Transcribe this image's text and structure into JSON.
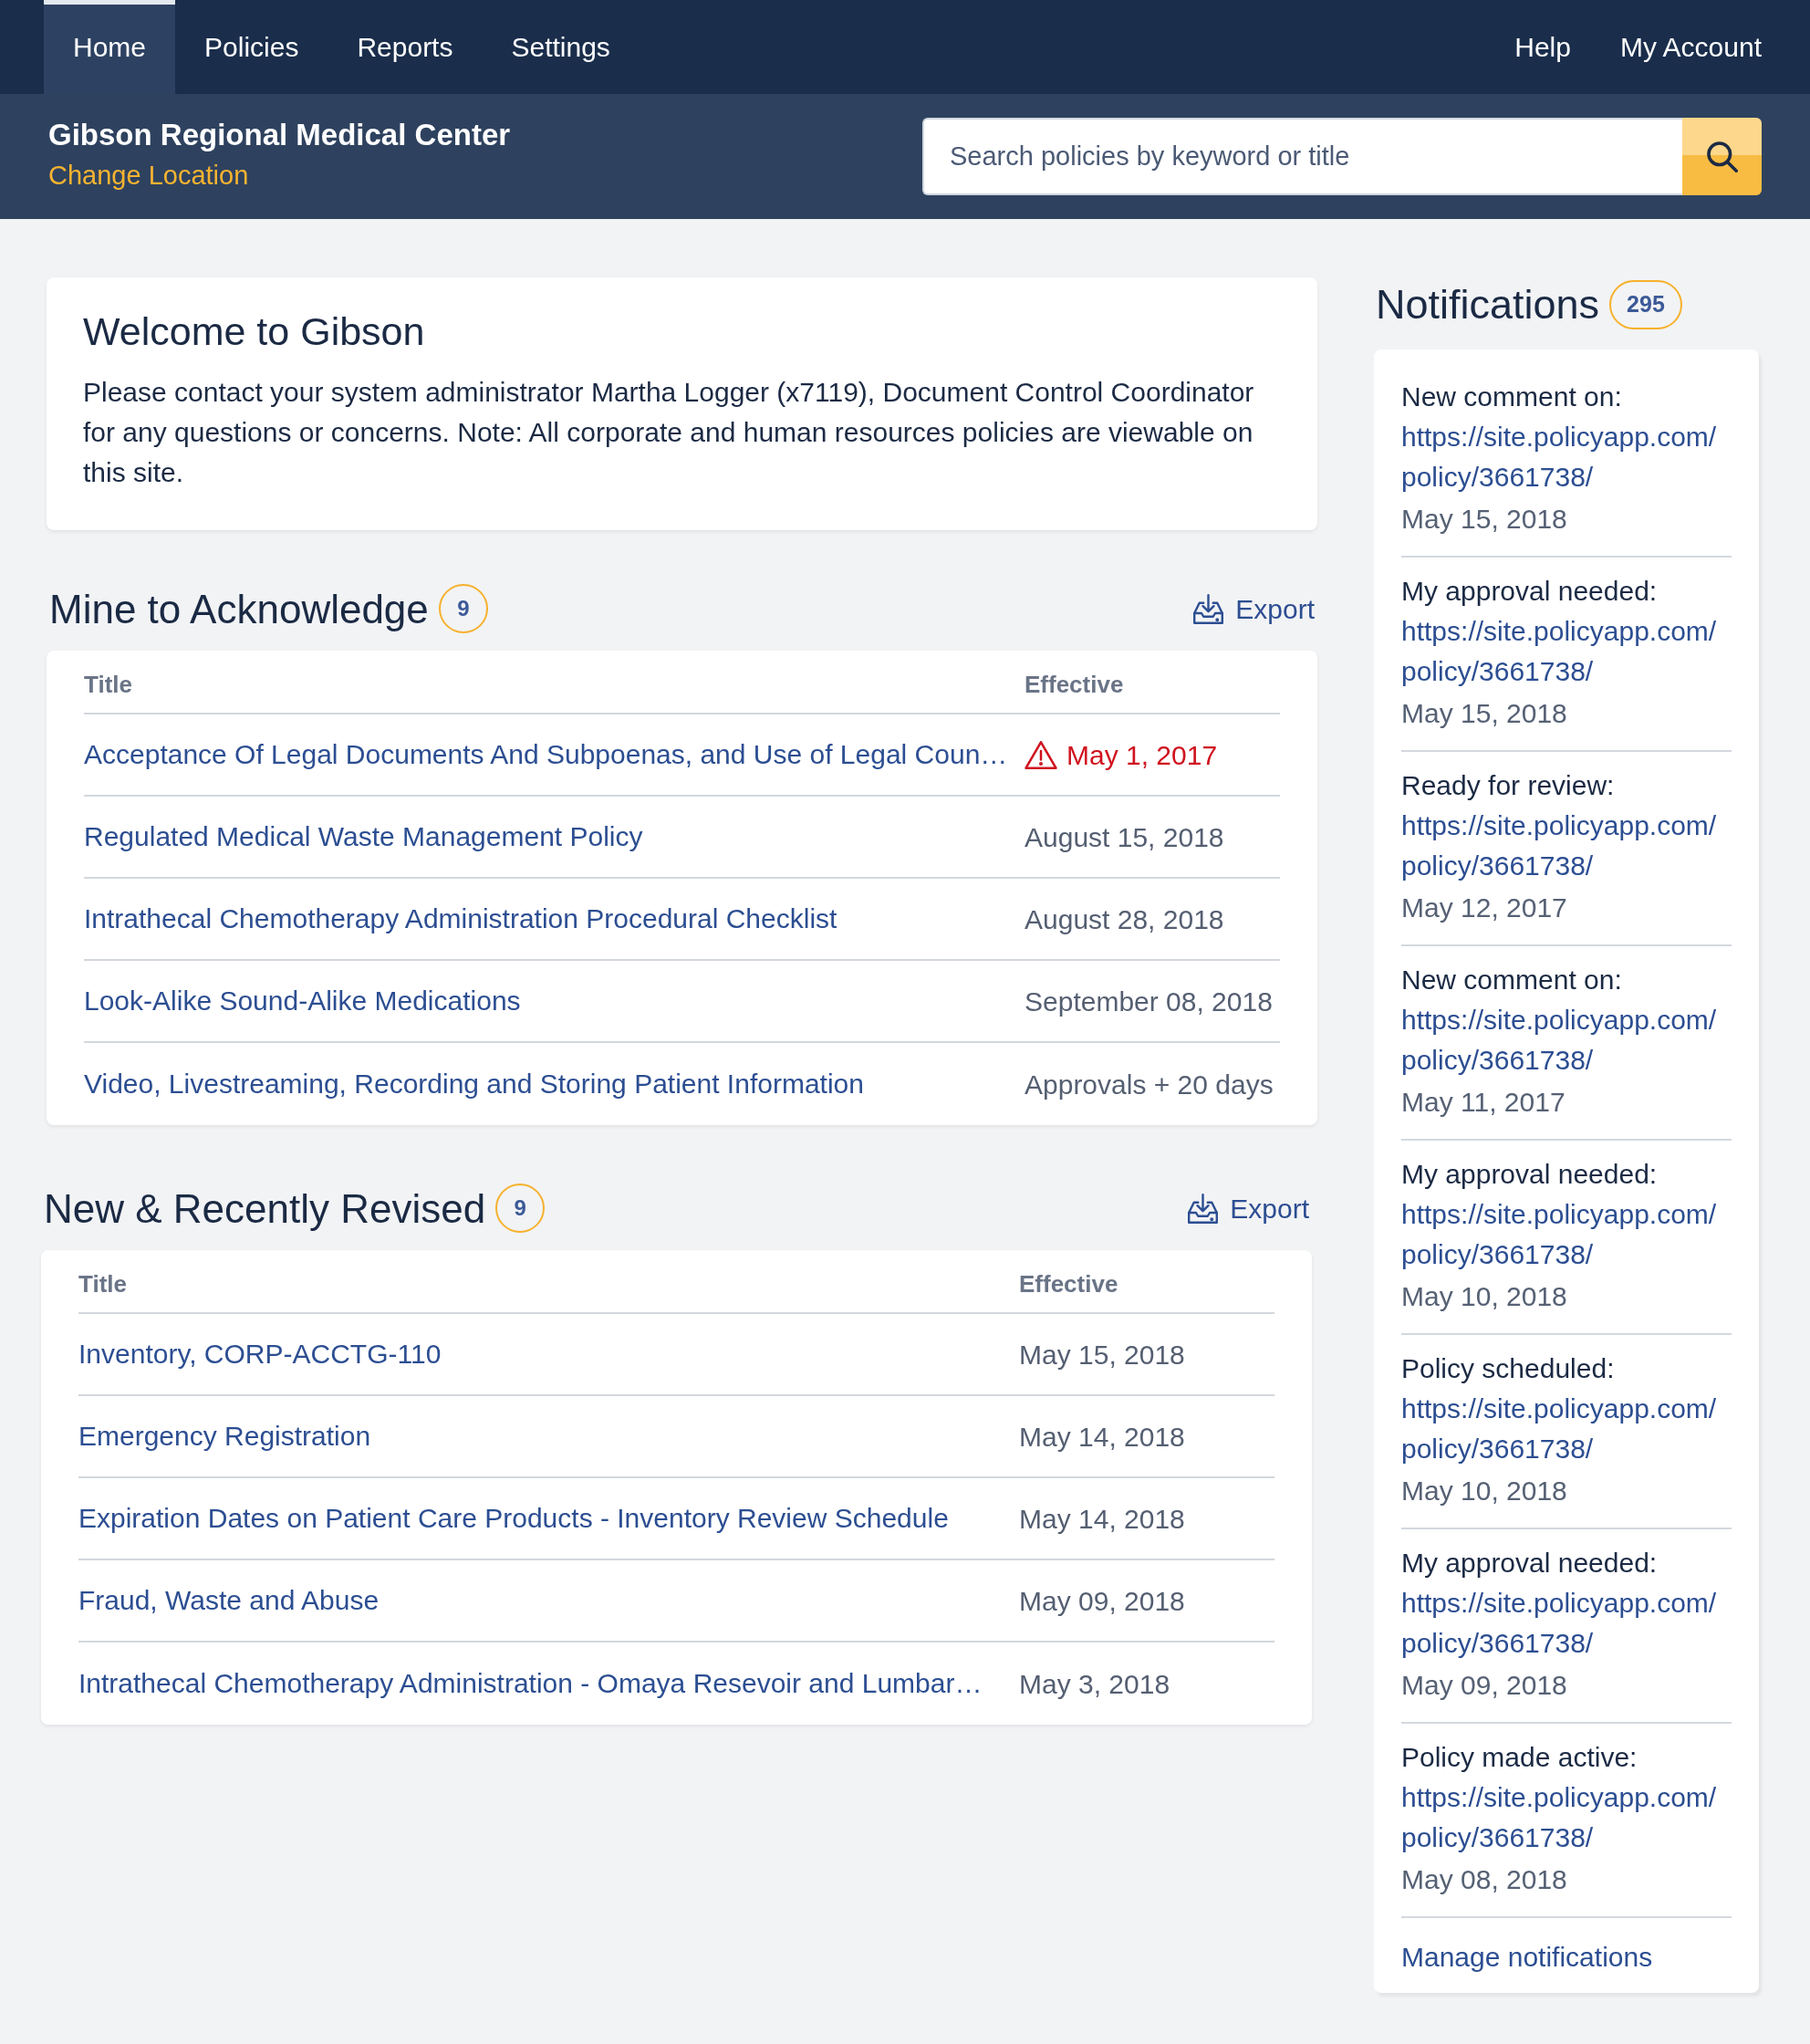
{
  "nav": {
    "tabs": [
      {
        "label": "Home",
        "selected": true
      },
      {
        "label": "Policies",
        "selected": false
      },
      {
        "label": "Reports",
        "selected": false
      },
      {
        "label": "Settings",
        "selected": false
      }
    ],
    "links": [
      "Help",
      "My Account"
    ]
  },
  "location": {
    "name": "Gibson Regional Medical Center",
    "change_link": "Change Location"
  },
  "search": {
    "placeholder": "Search policies by keyword or title"
  },
  "welcome": {
    "title": "Welcome to Gibson",
    "text": "Please contact your system administrator Martha Logger (x7119), Document Control Coordinator for any questions or concerns. Note: All corporate and human resources policies are viewable on this site."
  },
  "sections": [
    {
      "title": "Mine to Acknowledge",
      "count": "9",
      "export": "Export",
      "columns": [
        "Title",
        "Effective"
      ],
      "rows": [
        {
          "title": "Acceptance Of Legal Documents And Subpoenas, and Use of Legal Coun…",
          "effective": "May 1, 2017",
          "warning": true
        },
        {
          "title": "Regulated Medical Waste Management Policy",
          "effective": "August 15, 2018",
          "warning": false
        },
        {
          "title": "Intrathecal Chemotherapy Administration Procedural Checklist",
          "effective": "August 28, 2018",
          "warning": false
        },
        {
          "title": "Look-Alike Sound-Alike Medications",
          "effective": "September 08, 2018",
          "warning": false
        },
        {
          "title": "Video, Livestreaming, Recording and Storing Patient Information",
          "effective": "Approvals + 20 days",
          "warning": false
        }
      ]
    },
    {
      "title": "New & Recently Revised",
      "count": "9",
      "export": "Export",
      "columns": [
        "Title",
        "Effective"
      ],
      "rows": [
        {
          "title": "Inventory, CORP-ACCTG-110",
          "effective": "May 15, 2018",
          "warning": false
        },
        {
          "title": "Emergency Registration",
          "effective": "May 14, 2018",
          "warning": false
        },
        {
          "title": "Expiration Dates on Patient Care Products - Inventory Review Schedule",
          "effective": "May 14, 2018",
          "warning": false
        },
        {
          "title": "Fraud, Waste and Abuse",
          "effective": "May 09, 2018",
          "warning": false
        },
        {
          "title": "Intrathecal Chemotherapy Administration - Omaya Resevoir and Lumbar…",
          "effective": "May 3, 2018",
          "warning": false
        }
      ]
    }
  ],
  "notifications": {
    "title": "Notifications",
    "count": "295",
    "items": [
      {
        "label": "New comment on:",
        "link": "https://site.policyapp.com/policy/3661738/",
        "date": "May 15, 2018"
      },
      {
        "label": "My approval needed:",
        "link": "https://site.policyapp.com/policy/3661738/",
        "date": "May 15, 2018"
      },
      {
        "label": "Ready for review:",
        "link": "https://site.policyapp.com/policy/3661738/",
        "date": "May 12, 2017"
      },
      {
        "label": "New comment on:",
        "link": "https://site.policyapp.com/policy/3661738/",
        "date": "May 11, 2017"
      },
      {
        "label": "My approval needed:",
        "link": "https://site.policyapp.com/policy/3661738/",
        "date": "May 10, 2018"
      },
      {
        "label": "Policy scheduled:",
        "link": "https://site.policyapp.com/policy/3661738/",
        "date": "May 10, 2018"
      },
      {
        "label": "My approval needed:",
        "link": "https://site.policyapp.com/policy/3661738/",
        "date": "May 09, 2018"
      },
      {
        "label": "Policy made active:",
        "link": "https://site.policyapp.com/policy/3661738/",
        "date": "May 08, 2018"
      }
    ],
    "manage_link": "Manage notifications"
  }
}
